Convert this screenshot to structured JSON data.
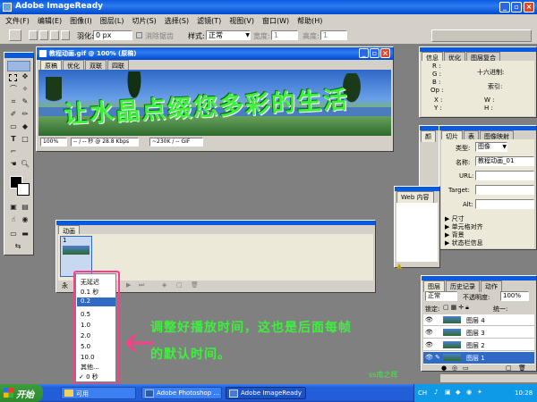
{
  "app": {
    "title": "Adobe ImageReady"
  },
  "menu": [
    "文件(F)",
    "编辑(E)",
    "图像(I)",
    "图层(L)",
    "切片(S)",
    "选择(S)",
    "滤镜(T)",
    "视图(V)",
    "窗口(W)",
    "帮助(H)"
  ],
  "options": {
    "feather_label": "羽化:",
    "feather_value": "0 px",
    "antialias_label": "消除锯齿",
    "style_label": "样式:",
    "style_value": "正常",
    "width_label": "宽度:",
    "width_value": "1",
    "height_label": "高度:",
    "height_value": "1"
  },
  "doc": {
    "title": "教程动画.gif @ 100% (原稿)",
    "tabs": [
      "原稿",
      "优化",
      "双联",
      "四联"
    ],
    "banner_text": "让水晶点缀您多彩的生活",
    "zoom": "100%",
    "speed": "-- / -- 秒 @ 28.8 Kbps",
    "size": "~230K / -- GIF"
  },
  "info": {
    "tabs": [
      "信息",
      "优化",
      "图层复合"
    ],
    "r": "R :",
    "g": "G :",
    "b": "B :",
    "op": "Op :",
    "hex": "十六进制:",
    "index": "索引:",
    "x": "X :",
    "y": "Y :",
    "w": "W :",
    "h": "H :"
  },
  "slice": {
    "tabs": [
      "切片",
      "表",
      "图像映射"
    ],
    "type_label": "类型:",
    "type_value": "图像",
    "name_label": "名称:",
    "name_value": "教程动画_01",
    "url_label": "URL:",
    "target_label": "Target:",
    "alt_label": "Alt:",
    "sections": [
      "尺寸",
      "单元格对齐",
      "背景",
      "状态栏信息"
    ]
  },
  "web": {
    "tab": "Web 内容"
  },
  "color": {
    "tab": "颜"
  },
  "anim": {
    "tab": "动画",
    "frame_no": "1",
    "frame_delay": "0 秒",
    "forever_label": "永"
  },
  "delay_menu": {
    "items": [
      "无延迟",
      "0.1 秒",
      "0.2",
      "0.5",
      "1.0",
      "2.0",
      "5.0",
      "10.0",
      "其他...",
      "0 秒"
    ],
    "selected_index": 2,
    "checked_index": 9
  },
  "layers": {
    "tabs": [
      "图层",
      "历史记录",
      "动作"
    ],
    "blend": "正常",
    "opacity_label": "不透明度:",
    "opacity_value": "100%",
    "lock_label": "锁定:",
    "unify_label": "统一:",
    "layer_names": [
      "图层 4",
      "图层 3",
      "图层 2",
      "图层 1"
    ],
    "selected_index": 3
  },
  "annotation": {
    "line1": "调整好播放时间，这也是后面每帧",
    "line2": "的默认时间。",
    "signature": "ss南之辉"
  },
  "taskbar": {
    "start": "开始",
    "items": [
      "可用",
      "Adobe Photoshop ...",
      "Adobe ImageReady"
    ],
    "lang": "CH",
    "time": "10:28"
  },
  "colors": {
    "accent": "#2a66e8",
    "annotation_green": "#3cf03c",
    "arrow_pink": "#ff3c8c"
  }
}
